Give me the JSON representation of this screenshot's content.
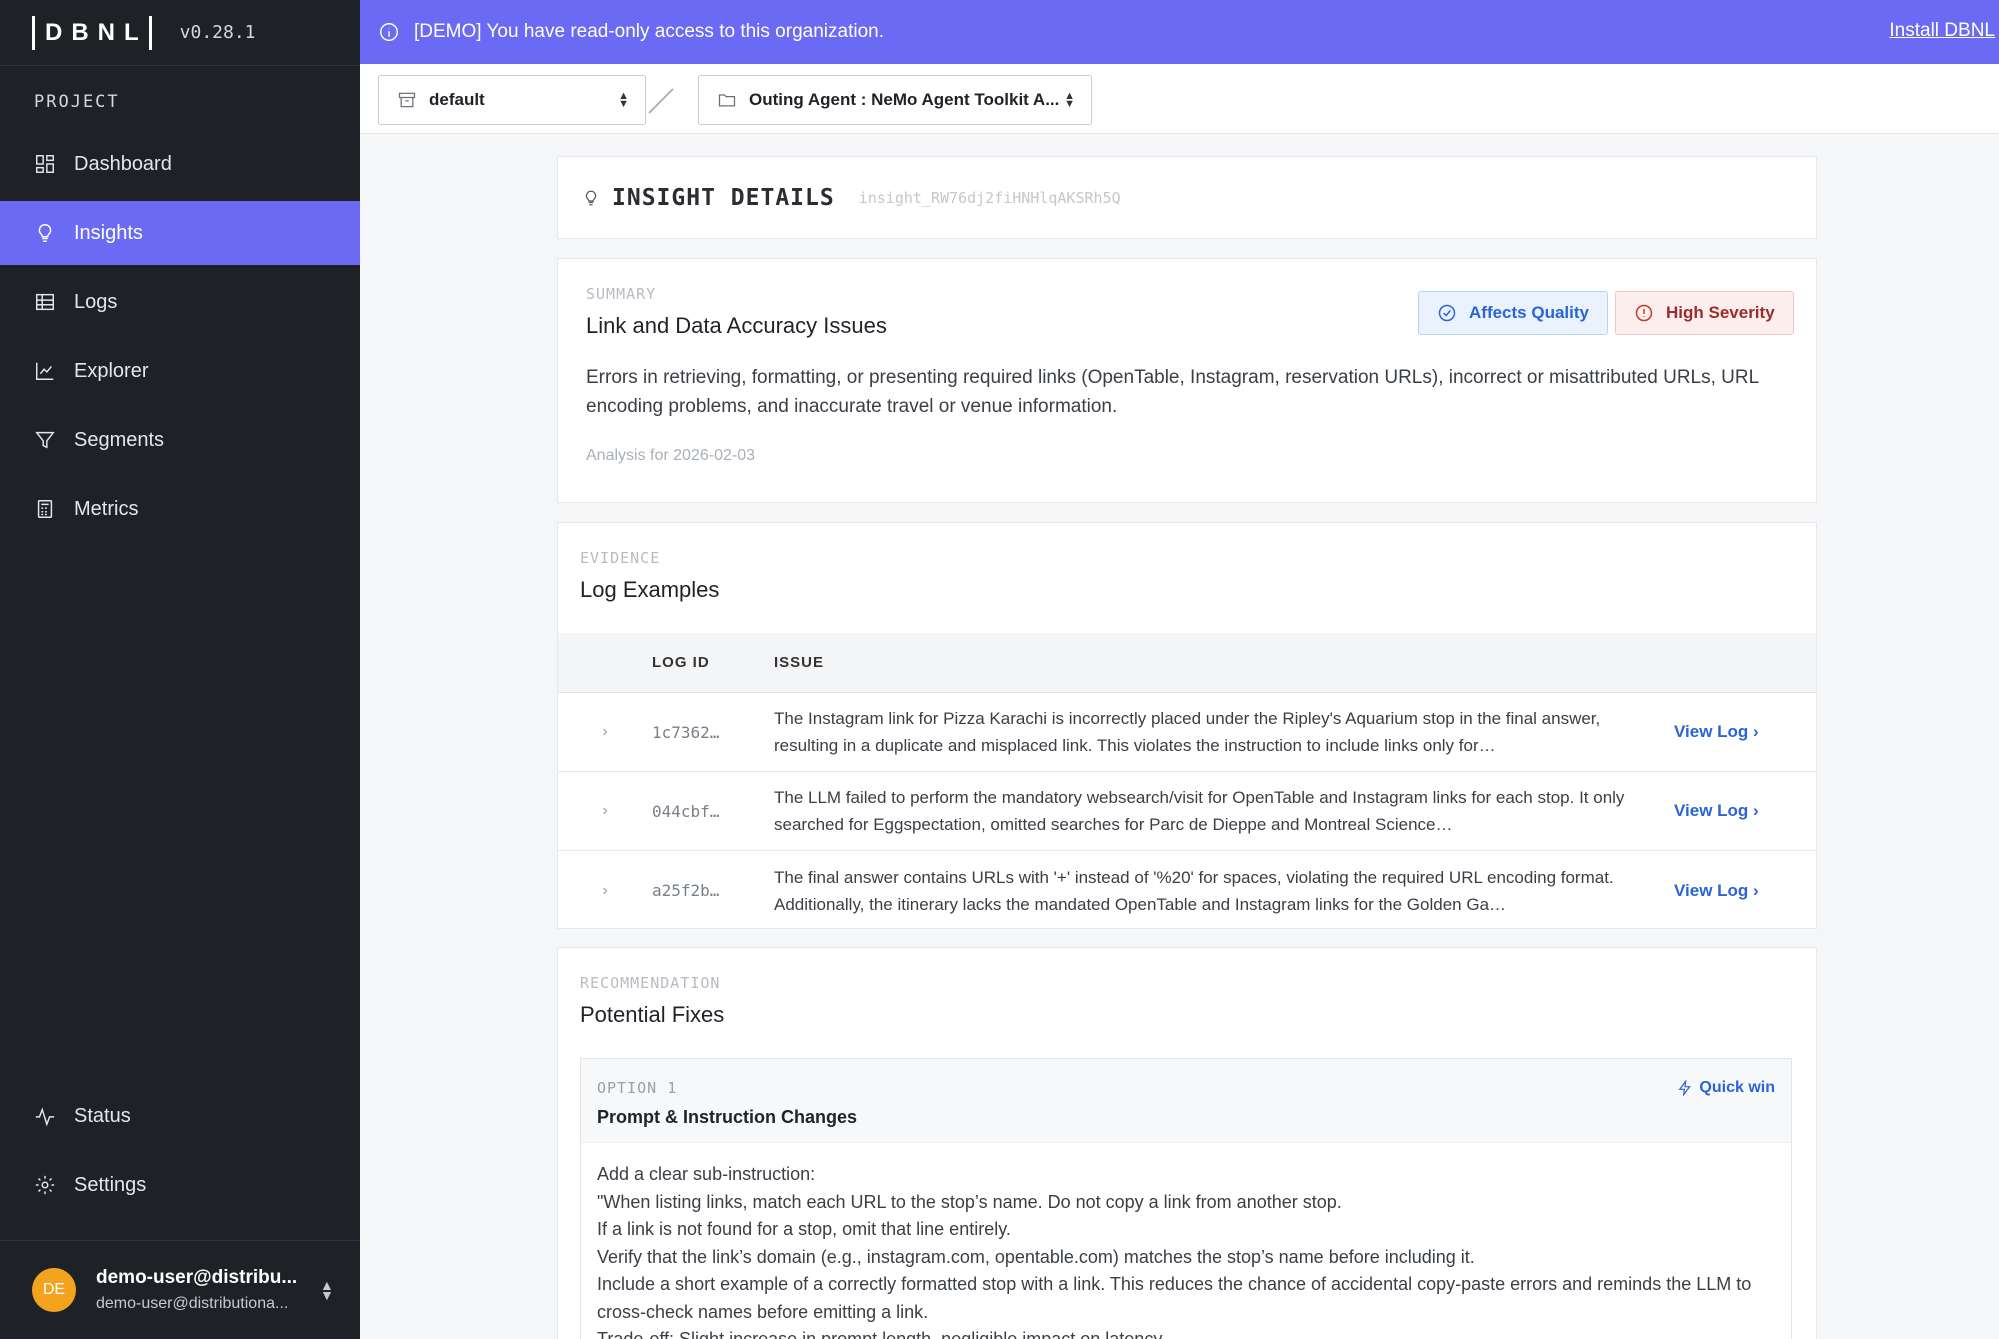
{
  "app": {
    "logo": "DBNL",
    "version": "v0.28.1"
  },
  "sidebar": {
    "section_label": "PROJECT",
    "items": [
      {
        "label": "Dashboard",
        "icon": "dashboard-icon"
      },
      {
        "label": "Insights",
        "icon": "lightbulb-icon",
        "active": true
      },
      {
        "label": "Logs",
        "icon": "table-icon"
      },
      {
        "label": "Explorer",
        "icon": "chart-line-icon"
      },
      {
        "label": "Segments",
        "icon": "filter-icon"
      },
      {
        "label": "Metrics",
        "icon": "calculator-icon"
      }
    ],
    "bottom_items": [
      {
        "label": "Status",
        "icon": "activity-icon"
      },
      {
        "label": "Settings",
        "icon": "gear-icon"
      }
    ],
    "user": {
      "initials": "DE",
      "name": "demo-user@distribu...",
      "email": "demo-user@distributiona..."
    }
  },
  "banner": {
    "text": "[DEMO] You have read-only access to this organization.",
    "link": "Install DBNL"
  },
  "toolbar": {
    "namespace": "default",
    "project": "Outing Agent : NeMo Agent Toolkit A..."
  },
  "insight": {
    "heading": "INSIGHT DETAILS",
    "id": "insight_RW76dj2fiHNHlqAKSRh5Q"
  },
  "summary": {
    "eyebrow": "SUMMARY",
    "title": "Link and Data Accuracy Issues",
    "badge_quality": "Affects Quality",
    "badge_severity": "High Severity",
    "body": "Errors in retrieving, formatting, or presenting required links (OpenTable, Instagram, reservation URLs), incorrect or misattributed URLs, URL encoding problems, and inaccurate travel or venue information.",
    "date": "Analysis for 2026-02-03"
  },
  "evidence": {
    "eyebrow": "EVIDENCE",
    "title": "Log Examples",
    "col_log_id": "LOG ID",
    "col_issue": "ISSUE",
    "view_label": "View Log",
    "rows": [
      {
        "log_id": "1c7362…",
        "issue": "The Instagram link for Pizza Karachi is incorrectly placed under the Ripley's Aquarium stop in the final answer, resulting in a duplicate and misplaced link. This violates the instruction to include links only for…"
      },
      {
        "log_id": "044cbf…",
        "issue": "The LLM failed to perform the mandatory websearch/visit for OpenTable and Instagram links for each stop. It only searched for Eggspectation, omitted searches for Parc de Dieppe and Montreal Science…"
      },
      {
        "log_id": "a25f2b…",
        "issue": "The final answer contains URLs with '+' instead of '%20' for spaces, violating the required URL encoding format. Additionally, the itinerary lacks the mandated OpenTable and Instagram links for the Golden Ga…"
      }
    ]
  },
  "recommendation": {
    "eyebrow": "RECOMMENDATION",
    "title": "Potential Fixes",
    "option": {
      "label": "OPTION 1",
      "title": "Prompt & Instruction Changes",
      "tag": "Quick win",
      "lines": [
        "Add a clear sub-instruction:",
        "\"When listing links, match each URL to the stop’s name. Do not copy a link from another stop.",
        "If a link is not found for a stop, omit that line entirely.",
        "Verify that the link’s domain (e.g., instagram.com, opentable.com) matches the stop’s name before including it.",
        "Include a short example of a correctly formatted stop with a link. This reduces the chance of accidental copy-paste errors and reminds the LLM to cross-check names before emitting a link.",
        "Trade-off: Slight increase in prompt length, negligible impact on latency."
      ]
    }
  }
}
